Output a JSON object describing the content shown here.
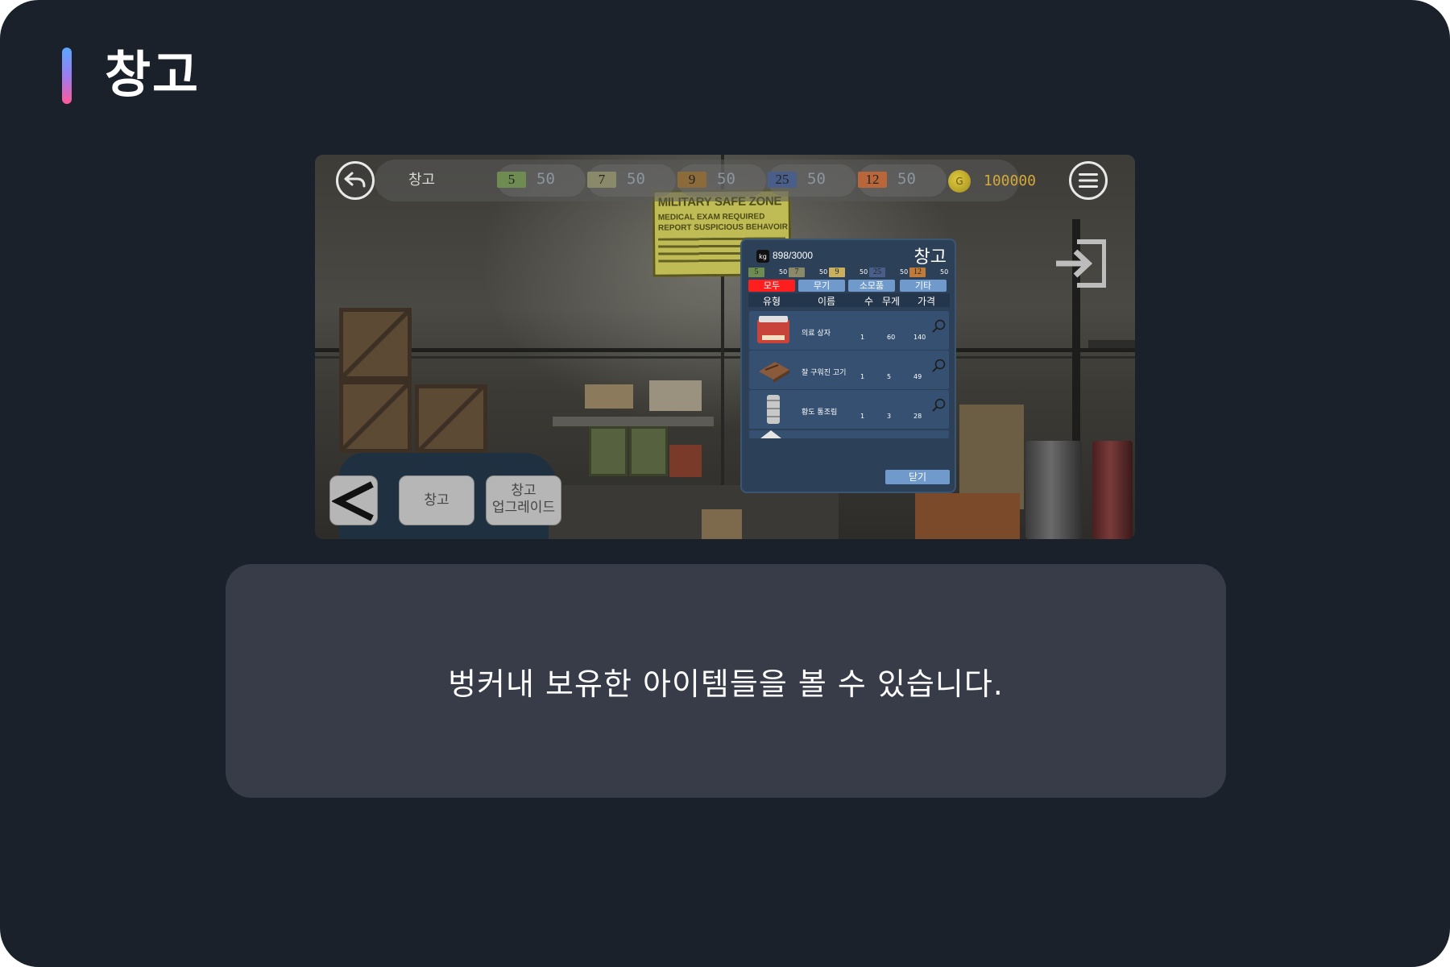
{
  "page": {
    "title": "창고"
  },
  "game": {
    "topbar": {
      "title": "창고",
      "resources": [
        {
          "icon": "5",
          "color": "#6e8c52",
          "value": "50"
        },
        {
          "icon": "7",
          "color": "#8a8a6a",
          "value": "50"
        },
        {
          "icon": "9",
          "color": "#8c6b3a",
          "value": "50"
        },
        {
          "icon": "25",
          "color": "#4a5e8a",
          "value": "50"
        },
        {
          "icon": "12",
          "color": "#b8663a",
          "value": "50"
        }
      ],
      "gold_icon": "G",
      "gold": "100000"
    },
    "sign": {
      "title": "MILITARY SAFE ZONE",
      "line1": "MEDICAL EXAM REQUIRED",
      "line2": "REPORT SUSPICIOUS BEHAVOIR"
    },
    "inventory": {
      "kg_icon": "kg",
      "weight": "898/3000",
      "title": "창고",
      "resources": [
        {
          "icon": "5",
          "color": "#6e8c52",
          "value": "50"
        },
        {
          "icon": "7",
          "color": "#8a8a6a",
          "value": "50"
        },
        {
          "icon": "9",
          "color": "#c9b060",
          "value": "50"
        },
        {
          "icon": "25",
          "color": "#4a5e8a",
          "value": "50"
        },
        {
          "icon": "12",
          "color": "#c07a3a",
          "value": "50"
        }
      ],
      "tabs": [
        {
          "label": "모두",
          "active": true
        },
        {
          "label": "무기",
          "active": false
        },
        {
          "label": "소모품",
          "active": false
        },
        {
          "label": "기타",
          "active": false
        }
      ],
      "columns": {
        "type": "유형",
        "name": "이름",
        "count": "수",
        "weight": "무게",
        "price": "가격"
      },
      "items": [
        {
          "name": "의료 상자",
          "count": "1",
          "weight": "60",
          "price": "140"
        },
        {
          "name": "잘 구워진 고기",
          "count": "1",
          "weight": "5",
          "price": "49"
        },
        {
          "name": "황도 통조림",
          "count": "1",
          "weight": "3",
          "price": "28"
        }
      ],
      "close": "닫기"
    },
    "bottom_buttons": {
      "back": "<",
      "warehouse": "창고",
      "upgrade_line1": "창고",
      "upgrade_line2": "업그레이드"
    },
    "colors": {
      "active_tab": "#ff1f1f",
      "tab": "#6f9acb",
      "panel": "#2c4058"
    }
  },
  "caption": "벙커내 보유한 아이템들을 볼 수 있습니다."
}
